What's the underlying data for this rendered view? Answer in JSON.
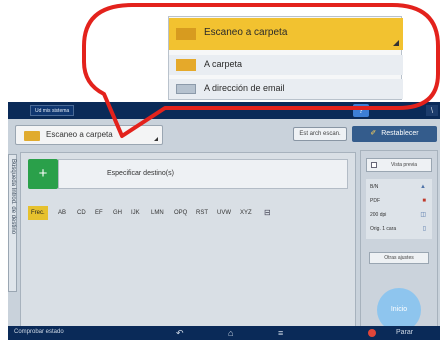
{
  "zoom_menu": {
    "items": [
      {
        "label": "Escaneo a carpeta",
        "icon": "folder-icon",
        "selected": true
      },
      {
        "label": "A carpeta",
        "icon": "folder-icon",
        "selected": false
      },
      {
        "label": "A dirección de email",
        "icon": "envelope-icon",
        "selected": false
      }
    ]
  },
  "topbar": {
    "tag": "Ud mis sistema",
    "help": "?",
    "user": "\\"
  },
  "toolbar": {
    "destination_value": "Escaneo a carpeta",
    "list_button": "Est arch escan.",
    "reset_button": "Restablecer"
  },
  "side_tab": {
    "label": "Búsqueda Introd. de destino"
  },
  "main": {
    "add_symbol": "+",
    "specify_label": "Especificar destino(s)",
    "alpha_tabs": [
      "Frec.",
      "AB",
      "CD",
      "EF",
      "GH",
      "IJK",
      "LMN",
      "OPQ",
      "RST",
      "UVW",
      "XYZ"
    ]
  },
  "right_panel": {
    "preview_label": "Vista previa",
    "settings": [
      {
        "label": "B/N",
        "icon": "triangle-icon"
      },
      {
        "label": "PDF",
        "icon": "pdf-icon"
      },
      {
        "label": "200 dpi",
        "icon": "dpi-icon"
      },
      {
        "label": "Orig. 1 cara",
        "icon": "page-icon"
      }
    ],
    "more_button": "Otras ajustes",
    "start_button": "Inicio"
  },
  "bottombar": {
    "left_text": "Comprobar estado",
    "stop_label": "Parar"
  },
  "colors": {
    "callout_red": "#e3221c",
    "selected_yellow": "#f2c230",
    "green_add": "#2aa04a",
    "topbar_navy": "#0a2a58"
  }
}
